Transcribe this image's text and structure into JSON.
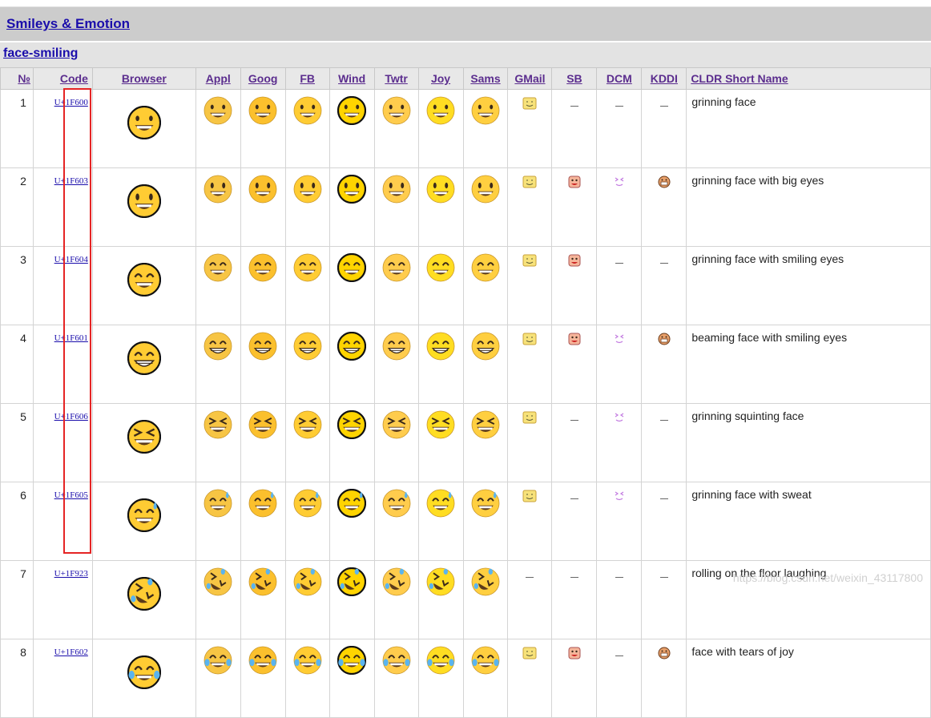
{
  "group_title": "Smileys & Emotion",
  "subgroup_title": "face-smiling",
  "headers": [
    "№",
    "Code",
    "Browser",
    "Appl",
    "Goog",
    "FB",
    "Wind",
    "Twtr",
    "Joy",
    "Sams",
    "GMail",
    "SB",
    "DCM",
    "KDDI",
    "CLDR Short Name"
  ],
  "rows": [
    {
      "num": "1",
      "code": "U+1F600",
      "name": "grinning face",
      "expr": "grin",
      "avail": {
        "sb": false,
        "dcm": false,
        "kddi": false
      }
    },
    {
      "num": "2",
      "code": "U+1F603",
      "name": "grinning face with big eyes",
      "expr": "bigeyes",
      "avail": {
        "sb": true,
        "dcm": true,
        "kddi": true
      }
    },
    {
      "num": "3",
      "code": "U+1F604",
      "name": "grinning face with smiling eyes",
      "expr": "smileeyes",
      "avail": {
        "sb": true,
        "dcm": false,
        "kddi": false
      }
    },
    {
      "num": "4",
      "code": "U+1F601",
      "name": "beaming face with smiling eyes",
      "expr": "beam",
      "avail": {
        "sb": true,
        "dcm": true,
        "kddi": true
      }
    },
    {
      "num": "5",
      "code": "U+1F606",
      "name": "grinning squinting face",
      "expr": "squint",
      "avail": {
        "sb": false,
        "dcm": true,
        "kddi": false
      }
    },
    {
      "num": "6",
      "code": "U+1F605",
      "name": "grinning face with sweat",
      "expr": "sweat",
      "avail": {
        "sb": false,
        "dcm": true,
        "kddi": false
      }
    },
    {
      "num": "7",
      "code": "U+1F923",
      "name": "rolling on the floor laughing",
      "expr": "rofl",
      "avail": {
        "sb": false,
        "dcm": false,
        "kddi": false,
        "gmail": false
      }
    },
    {
      "num": "8",
      "code": "U+1F602",
      "name": "face with tears of joy",
      "expr": "joy",
      "avail": {
        "sb": true,
        "dcm": false,
        "kddi": true
      }
    }
  ],
  "vendor_colors": {
    "appl": "#f7c544",
    "goog": "#fbc02d",
    "fb": "#ffcc33",
    "wind": "#ffd400",
    "twtr": "#ffcc4d",
    "joy": "#ffdd22",
    "sams": "#ffcf40",
    "browser": "#ffcc33"
  },
  "watermark": "https://blog.csdn.net/weixin_43117800"
}
